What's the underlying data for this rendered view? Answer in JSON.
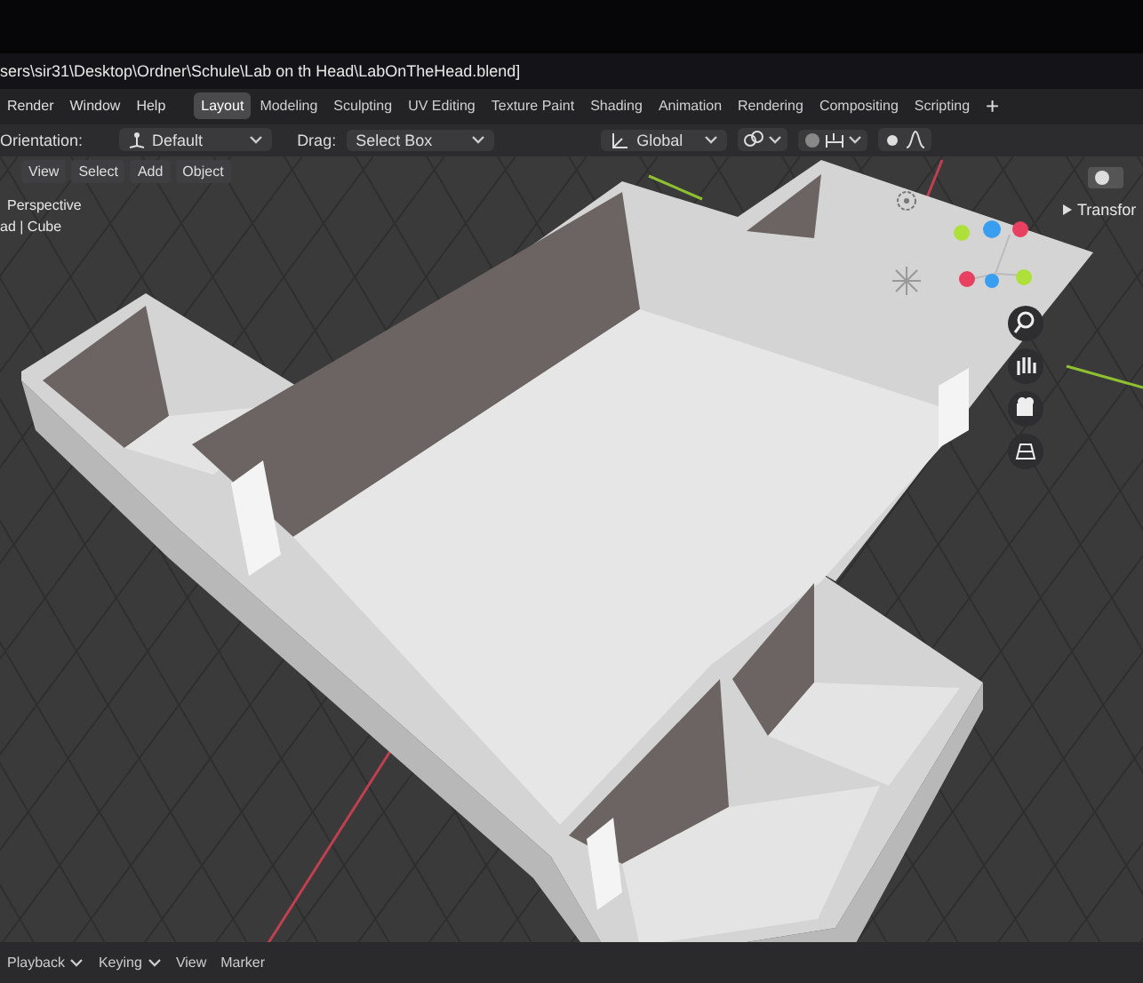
{
  "title_bar": {
    "path": "sers\\sir31\\Desktop\\Ordner\\Schule\\Lab on th Head\\LabOnTheHead.blend]"
  },
  "menu": [
    "Render",
    "Window",
    "Help"
  ],
  "workspace_tabs": [
    {
      "label": "Layout",
      "selected": true
    },
    {
      "label": "Modeling",
      "selected": false
    },
    {
      "label": "Sculpting",
      "selected": false
    },
    {
      "label": "UV Editing",
      "selected": false
    },
    {
      "label": "Texture Paint",
      "selected": false
    },
    {
      "label": "Shading",
      "selected": false
    },
    {
      "label": "Animation",
      "selected": false
    },
    {
      "label": "Rendering",
      "selected": false
    },
    {
      "label": "Compositing",
      "selected": false
    },
    {
      "label": "Scripting",
      "selected": false
    }
  ],
  "add_tab": "+",
  "tool_header": {
    "orientation_label": "Orientation:",
    "orientation": "Default",
    "drag_label": "Drag:",
    "drag": "Select Box",
    "transform_space": "Global"
  },
  "viewport_header": {
    "menus": [
      "View",
      "Select",
      "Add",
      "Object"
    ]
  },
  "viewport": {
    "view_name": "Perspective",
    "collection": "ad | Cube",
    "sidebar_tab": "Transfor"
  },
  "timeline": {
    "menus": [
      {
        "label": "Playback",
        "caret": true
      },
      {
        "label": "Keying",
        "caret": true
      },
      {
        "label": "View",
        "caret": false
      },
      {
        "label": "Marker",
        "caret": false
      }
    ]
  }
}
